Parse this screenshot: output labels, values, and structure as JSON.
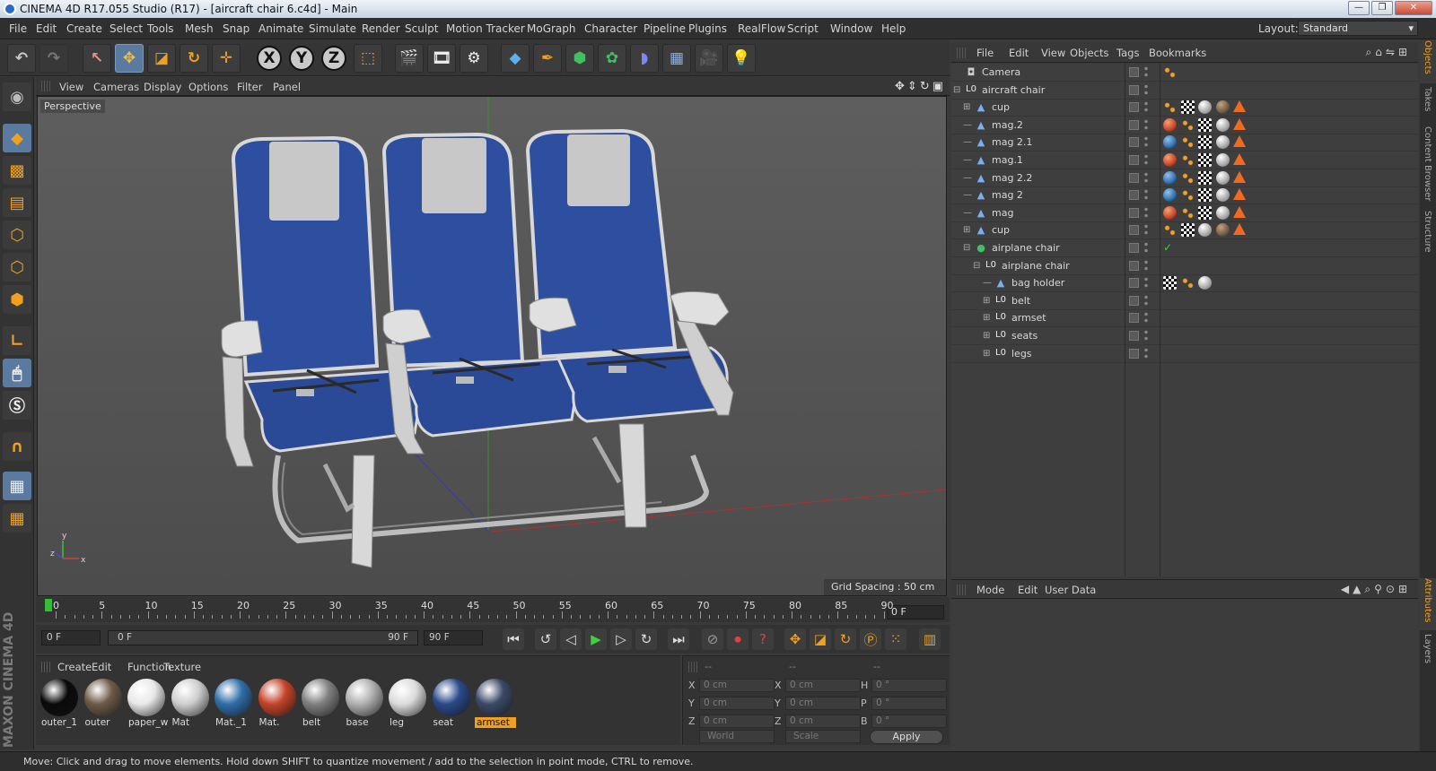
{
  "window": {
    "title": "CINEMA 4D R17.055 Studio (R17) - [aircraft chair 6.c4d] - Main",
    "minimize": "—",
    "restore": "❐",
    "close": "✕"
  },
  "menubar": {
    "items": [
      "File",
      "Edit",
      "Create",
      "Select",
      "Tools",
      "Mesh",
      "Snap",
      "Animate",
      "Simulate",
      "Render",
      "Sculpt",
      "Motion Tracker",
      "MoGraph",
      "Character",
      "Pipeline",
      "Plugins",
      "RealFlow",
      "Script",
      "Window",
      "Help"
    ],
    "layout_label": "Layout:",
    "layout_value": "Standard"
  },
  "viewport": {
    "menu": [
      "View",
      "Cameras",
      "Display",
      "Options",
      "Filter",
      "Panel"
    ],
    "label": "Perspective",
    "grid_spacing": "Grid Spacing : 50 cm",
    "axis_labels": {
      "x": "x",
      "y": "y",
      "z": "z"
    }
  },
  "timeline": {
    "ticks": [
      "0",
      "5",
      "10",
      "15",
      "20",
      "25",
      "30",
      "35",
      "40",
      "45",
      "50",
      "55",
      "60",
      "65",
      "70",
      "75",
      "80",
      "85",
      "90"
    ],
    "current_frame": "0 F"
  },
  "transport": {
    "start_field": "0 F",
    "range_start": "0 F",
    "range_end": "90 F",
    "end_field": "90 F"
  },
  "materials": {
    "menu": [
      "Create",
      "Edit",
      "Function",
      "Texture"
    ],
    "items": [
      {
        "name": "outer_1",
        "color": "#0a0a0a"
      },
      {
        "name": "outer",
        "color": "#6e5a48"
      },
      {
        "name": "paper_w",
        "color": "#e8e8e8"
      },
      {
        "name": "Mat",
        "color": "#cfcfcf"
      },
      {
        "name": "Mat._1",
        "color": "#2f6ea8"
      },
      {
        "name": "Mat.",
        "color": "#c4442a"
      },
      {
        "name": "belt",
        "color": "#808080"
      },
      {
        "name": "base",
        "color": "#b0b0b0"
      },
      {
        "name": "leg",
        "color": "#dcdcdc"
      },
      {
        "name": "seat",
        "color": "#2a4a8a"
      },
      {
        "name": "armset",
        "color": "#3c4a68",
        "active": true
      }
    ]
  },
  "coords": {
    "headers": [
      "--",
      "--",
      "--"
    ],
    "rows": [
      {
        "l1": "X",
        "v1": "0 cm",
        "l2": "X",
        "v2": "0 cm",
        "l3": "H",
        "v3": "0 °"
      },
      {
        "l1": "Y",
        "v1": "0 cm",
        "l2": "Y",
        "v2": "0 cm",
        "l3": "P",
        "v3": "0 °"
      },
      {
        "l1": "Z",
        "v1": "0 cm",
        "l2": "Z",
        "v2": "0 cm",
        "l3": "B",
        "v3": "0 °"
      }
    ],
    "world": "World",
    "scale": "Scale",
    "apply": "Apply"
  },
  "object_manager": {
    "menu": [
      "File",
      "Edit",
      "View",
      "Objects",
      "Tags",
      "Bookmarks"
    ],
    "rows": [
      {
        "name": "Camera",
        "icon": "camera",
        "depth": 0,
        "tags": [
          "dots"
        ]
      },
      {
        "name": "aircraft chair",
        "icon": "null",
        "depth": 0,
        "tags": []
      },
      {
        "name": "cup",
        "icon": "poly",
        "depth": 1,
        "tags": [
          "dots",
          "checker",
          "sphere-white",
          "sphere-brown",
          "warning"
        ]
      },
      {
        "name": "mag.2",
        "icon": "poly",
        "depth": 1,
        "tags": [
          "sphere-red",
          "dots",
          "checker",
          "sphere-white",
          "warning"
        ]
      },
      {
        "name": "mag 2.1",
        "icon": "poly",
        "depth": 1,
        "tags": [
          "sphere-blue",
          "dots",
          "checker",
          "sphere-white",
          "warning"
        ]
      },
      {
        "name": "mag.1",
        "icon": "poly",
        "depth": 1,
        "tags": [
          "sphere-red",
          "dots",
          "checker",
          "sphere-white",
          "warning"
        ]
      },
      {
        "name": "mag 2.2",
        "icon": "poly",
        "depth": 1,
        "tags": [
          "sphere-blue",
          "dots",
          "checker",
          "sphere-white",
          "warning"
        ]
      },
      {
        "name": "mag 2",
        "icon": "poly",
        "depth": 1,
        "tags": [
          "sphere-blue",
          "dots",
          "checker",
          "sphere-white",
          "warning"
        ]
      },
      {
        "name": "mag",
        "icon": "poly",
        "depth": 1,
        "tags": [
          "sphere-red",
          "dots",
          "checker",
          "sphere-white",
          "warning"
        ]
      },
      {
        "name": "cup",
        "icon": "poly",
        "depth": 1,
        "tags": [
          "dots",
          "checker",
          "sphere-white",
          "sphere-brown",
          "warning"
        ]
      },
      {
        "name": "airplane chair",
        "icon": "gen",
        "depth": 1,
        "tags": [
          "check"
        ]
      },
      {
        "name": "airplane chair",
        "icon": "null",
        "depth": 2,
        "tags": []
      },
      {
        "name": "bag holder",
        "icon": "poly",
        "depth": 3,
        "tags": [
          "checker",
          "dots",
          "sphere-white"
        ]
      },
      {
        "name": "belt",
        "icon": "null",
        "depth": 3,
        "tags": []
      },
      {
        "name": "armset",
        "icon": "null",
        "depth": 3,
        "tags": []
      },
      {
        "name": "seats",
        "icon": "null",
        "depth": 3,
        "tags": []
      },
      {
        "name": "legs",
        "icon": "null",
        "depth": 3,
        "tags": []
      }
    ]
  },
  "attributes": {
    "menu": [
      "Mode",
      "Edit",
      "User Data"
    ]
  },
  "side_tabs": {
    "top": [
      "Objects",
      "Takes",
      "Content Browser",
      "Structure"
    ],
    "bottom": [
      "Attributes",
      "Layers"
    ]
  },
  "branding": {
    "text": "MAXON CINEMA 4D"
  },
  "status": "Move: Click and drag to move elements. Hold down SHIFT to quantize movement / add to the selection in point mode, CTRL to remove."
}
